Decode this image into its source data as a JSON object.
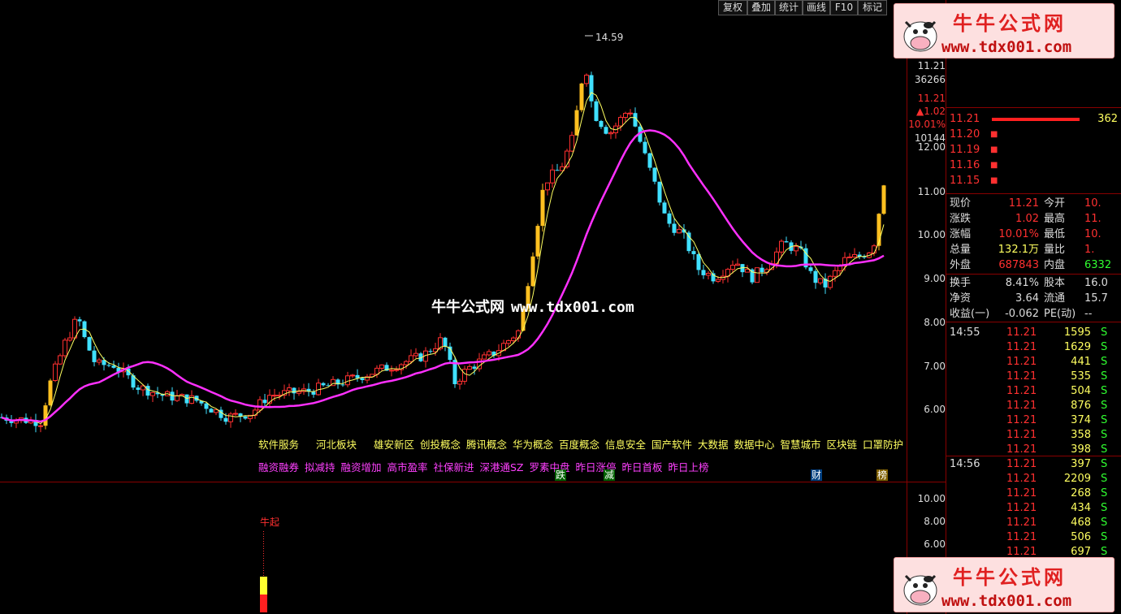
{
  "toolbar": {
    "items": [
      "复权",
      "叠加",
      "统计",
      "画线",
      "F10",
      "标记"
    ]
  },
  "chart": {
    "price_ticks": [
      "12.00",
      "11.00",
      "10.00",
      "9.00",
      "8.00",
      "7.00",
      "6.00"
    ],
    "lower_ticks": [
      "10.00",
      "8.00",
      "6.00"
    ],
    "high_label": "14.59",
    "right_info": {
      "price": "11.21",
      "vol": "36266",
      "price2": "11.21",
      "change": "▲1.02",
      "pct": "10.01%",
      "v2": "10144"
    },
    "concepts_yellow": [
      "软件服务",
      "河北板块",
      "雄安新区",
      "创投概念",
      "腾讯概念",
      "华为概念",
      "百度概念",
      "信息安全",
      "国产软件",
      "大数据",
      "数据中心",
      "智慧城市",
      "区块链",
      "口罩防护"
    ],
    "concepts_magenta": [
      "融资融券",
      "拟减持",
      "融资增加",
      "高市盈率",
      "社保新进",
      "深港通SZ",
      "罗素中盘",
      "昨日涨停",
      "昨日首板",
      "昨日上榜"
    ],
    "tags": {
      "die": "跌",
      "jian": "减",
      "cai": "财",
      "bang": "榜"
    },
    "lower_label": "牛起",
    "watermark": {
      "cn": "牛牛公式网",
      "en": "www.tdx001.com"
    }
  },
  "order_book": {
    "bids": [
      {
        "price": "11.21",
        "vol": "362"
      },
      {
        "price": "11.20",
        "vol": ""
      },
      {
        "price": "11.19",
        "vol": ""
      },
      {
        "price": "11.16",
        "vol": ""
      },
      {
        "price": "11.15",
        "vol": ""
      }
    ]
  },
  "quote": {
    "rows": [
      {
        "l1": "现价",
        "v1": "11.21",
        "l2": "今开",
        "v2": "10."
      },
      {
        "l1": "涨跌",
        "v1": "1.02",
        "l2": "最高",
        "v2": "11."
      },
      {
        "l1": "涨幅",
        "v1": "10.01%",
        "l2": "最低",
        "v2": "10."
      },
      {
        "l1": "总量",
        "v1": "132.1万",
        "l2": "量比",
        "v2": "1."
      },
      {
        "l1": "外盘",
        "v1": "687843",
        "l2": "内盘",
        "v2": "6332"
      },
      {
        "l1": "换手",
        "v1": "8.41%",
        "l2": "股本",
        "v2": "16.0"
      },
      {
        "l1": "净资",
        "v1": "3.64",
        "l2": "流通",
        "v2": "15.7"
      },
      {
        "l1": "收益(一)",
        "v1": "-0.062",
        "l2": "PE(动)",
        "v2": "--"
      }
    ]
  },
  "ticks": {
    "times": [
      "14:55",
      "14:56"
    ],
    "rows": [
      {
        "p": "11.21",
        "v": "1595",
        "s": "S"
      },
      {
        "p": "11.21",
        "v": "1629",
        "s": "S"
      },
      {
        "p": "11.21",
        "v": "441",
        "s": "S"
      },
      {
        "p": "11.21",
        "v": "535",
        "s": "S"
      },
      {
        "p": "11.21",
        "v": "504",
        "s": "S"
      },
      {
        "p": "11.21",
        "v": "876",
        "s": "S"
      },
      {
        "p": "11.21",
        "v": "374",
        "s": "S"
      },
      {
        "p": "11.21",
        "v": "358",
        "s": "S"
      },
      {
        "p": "11.21",
        "v": "398",
        "s": "S"
      },
      {
        "p": "11.21",
        "v": "397",
        "s": "S"
      },
      {
        "p": "11.21",
        "v": "2209",
        "s": "S"
      },
      {
        "p": "11.21",
        "v": "268",
        "s": "S"
      },
      {
        "p": "11.21",
        "v": "434",
        "s": "S"
      },
      {
        "p": "11.21",
        "v": "468",
        "s": "S"
      },
      {
        "p": "11.21",
        "v": "506",
        "s": "S"
      },
      {
        "p": "11.21",
        "v": "697",
        "s": "S"
      }
    ]
  },
  "banner": {
    "cn": "牛牛公式网",
    "url": "www.tdx001.com",
    "url2": "www.tdx001.com"
  },
  "colors": {
    "up": "#ff3030",
    "down": "#40e0ff",
    "ma": "#ff30ff",
    "line": "#ffff60"
  }
}
